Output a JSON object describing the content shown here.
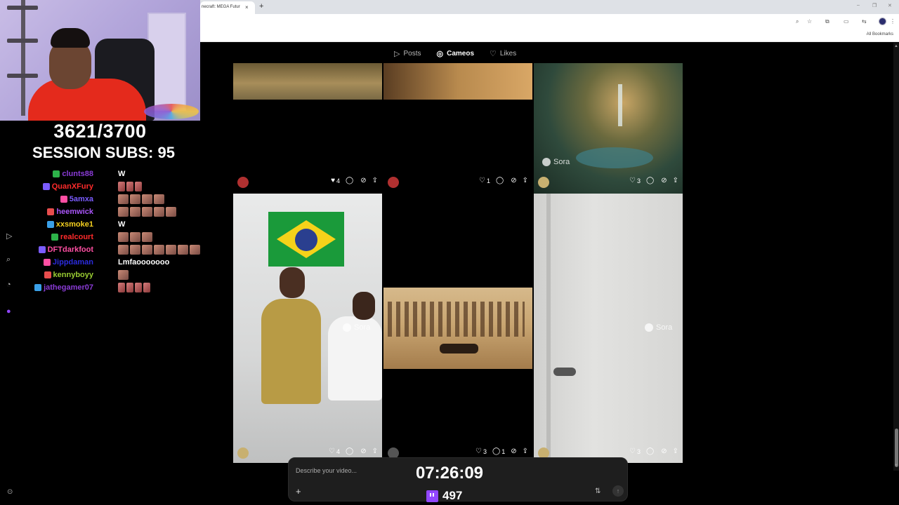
{
  "browser": {
    "tab_title": "necraft: MEGA Futur",
    "tab_close": "×",
    "new_tab": "+",
    "window_minimize": "–",
    "window_restore": "❐",
    "window_close": "✕",
    "toolbar_icons": {
      "zoom": "⌕",
      "star": "☆",
      "extensions": "⧉",
      "sidebar": "▭",
      "translate": "⇆",
      "menu": "⋮"
    },
    "bookmarks_label": "All Bookmarks"
  },
  "stream_overlay": {
    "goal_counter": "3621/3700",
    "session_subs": "SESSION SUBS: 95",
    "timer": "07:26:09",
    "viewer_count": "497"
  },
  "chat": [
    {
      "username": "clunts88",
      "color": "#8a3bd6",
      "message": "W",
      "emotes": 0
    },
    {
      "username": "QuanXFury",
      "color": "#ff2b2b",
      "message": "",
      "emotes": 3,
      "emote_style": "small"
    },
    {
      "username": "5amxa",
      "color": "#7b5cff",
      "message": "",
      "emotes": 4
    },
    {
      "username": "heemwick",
      "color": "#a855f7",
      "message": "",
      "emotes": 5
    },
    {
      "username": "xxsmoke1",
      "color": "#f5d020",
      "message": "W",
      "emotes": 0
    },
    {
      "username": "realcourt",
      "color": "#ff2b2b",
      "message": "",
      "emotes": 3
    },
    {
      "username": "DFTdarkfoot",
      "color": "#ff4fa3",
      "message": "",
      "emotes": 7
    },
    {
      "username": "Jippdaman",
      "color": "#2b2bdd",
      "message": "Lmfaooooooo",
      "emotes": 0
    },
    {
      "username": "kennyboyy",
      "color": "#9acd32",
      "message": "",
      "emotes": 1
    },
    {
      "username": "jathegamer07",
      "color": "#8a3bd6",
      "message": "",
      "emotes": 4,
      "emote_style": "small"
    }
  ],
  "sora": {
    "tabs": [
      {
        "label": "Posts",
        "icon": "▷",
        "active": false
      },
      {
        "label": "Cameos",
        "icon": "◎",
        "active": true
      },
      {
        "label": "Likes",
        "icon": "♡",
        "active": false
      }
    ],
    "watermark": "Sora",
    "cards": [
      {
        "likes": "4",
        "liked": true,
        "comments": "",
        "remixes": ""
      },
      {
        "likes": "1",
        "liked": false,
        "comments": "",
        "remixes": ""
      },
      {
        "likes": "3",
        "liked": false,
        "comments": "",
        "remixes": ""
      },
      {
        "likes": "4",
        "liked": false,
        "comments": "",
        "remixes": ""
      },
      {
        "likes": "3",
        "liked": false,
        "comments": "1",
        "remixes": ""
      },
      {
        "likes": "3",
        "liked": false,
        "comments": "",
        "remixes": ""
      }
    ],
    "composer": {
      "placeholder": "Describe your video...",
      "add_icon": "+",
      "settings_icon": "⇅",
      "send_icon": "↑"
    }
  },
  "colors": {
    "accent_twitch": "#9146ff",
    "site_background": "#000000",
    "composer_background": "#1e1e1e"
  }
}
